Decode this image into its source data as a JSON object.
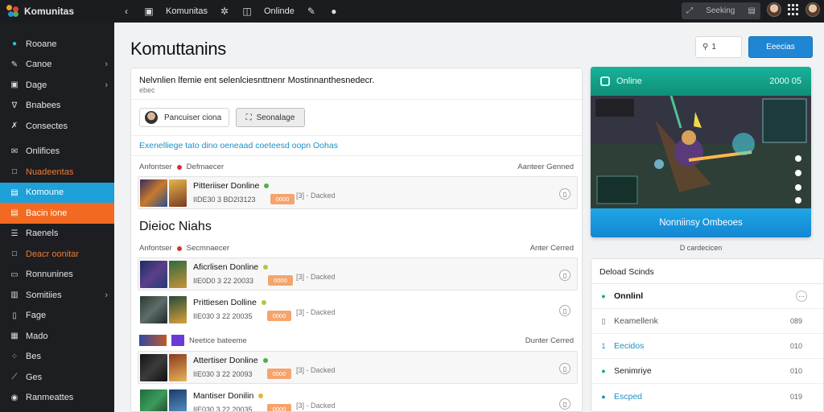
{
  "app": {
    "brand": "Komunitas"
  },
  "topnav": {
    "title": "Komunitas",
    "item": "Onlinde"
  },
  "search": {
    "placeholder": "Seeking"
  },
  "sidebar": {
    "items": [
      {
        "label": "Rooane",
        "icon": "shield-icon"
      },
      {
        "label": "Canoe",
        "icon": "wrench-icon",
        "chevron": true
      },
      {
        "label": "Dage",
        "icon": "folder-icon",
        "chevron": true
      },
      {
        "label": "Bnabees",
        "icon": "cup-icon"
      },
      {
        "label": "Consectes",
        "icon": "tools-icon"
      },
      {
        "label": "Onlifices",
        "icon": "mail-icon"
      },
      {
        "label": "Nuadeentas",
        "icon": "square-icon"
      },
      {
        "label": "Komoune",
        "icon": "card-icon"
      },
      {
        "label": "Bacin ione",
        "icon": "card-icon"
      },
      {
        "label": "Raenels",
        "icon": "list-icon"
      },
      {
        "label": "Deacr oonitar",
        "icon": "square-icon"
      },
      {
        "label": "Ronnunines",
        "icon": "layers-icon"
      },
      {
        "label": "Somitiies",
        "icon": "cards-icon",
        "chevron": true
      },
      {
        "label": "Fage",
        "icon": "page-icon"
      },
      {
        "label": "Mado",
        "icon": "grid-icon"
      },
      {
        "label": "Bes",
        "icon": "dots-icon"
      },
      {
        "label": "Ges",
        "icon": "wand-icon"
      },
      {
        "label": "Ranmeattes",
        "icon": "circle-icon"
      }
    ]
  },
  "main": {
    "title": "Komuttanins",
    "small_input": "1",
    "primary_button": "Eeecias"
  },
  "feed": {
    "heading": "Nelvnlien lfemie ent selenlciesnttnenr Mostinnanthesnedecr.",
    "subheading": "ebec",
    "user_chip": "Pancuiser ciona",
    "ghost_button": "Seonalage",
    "link_text": "Exenelliege tato dino oeneaad coeteesd oopn Oohas",
    "section1": {
      "lead": "Anfontser",
      "tag": "Defmaecer",
      "right": "Aanteer Genned"
    },
    "section2_title": "Dieioc Niahs",
    "section2": {
      "lead": "Anfontser",
      "tag": "Secmnaecer",
      "right": "Anter Cerred"
    },
    "section3": {
      "tag": "Neetice bateeme",
      "right": "Dunter Cerred"
    },
    "rows": [
      {
        "title": "Pitteriiser Donline",
        "meta": "IIDE30 3 BD2I3123",
        "pill": "0000",
        "stat": "[3] - Dacked",
        "dot": "g"
      },
      {
        "title": "Aficrlisen Donline",
        "meta": "IIE0D0 3 22 20033",
        "pill": "0000",
        "stat": "[3] - Dacked",
        "dot": "y"
      },
      {
        "title": "Prittiesen Dolline",
        "meta": "IIE030 3 22 20035",
        "pill": "0000",
        "stat": "[3] - Dacked",
        "dot": "y"
      },
      {
        "title": "Attertiser Donline",
        "meta": "IIE030 3 22 20093",
        "pill": "0000",
        "stat": "[3] - Dacked",
        "dot": "g"
      },
      {
        "title": "Mantiser Donilin",
        "meta": "IIE030 3 22 20035",
        "pill": "0000",
        "stat": "[3] - Dacked",
        "dot": "o"
      }
    ]
  },
  "live": {
    "label": "Online",
    "count": "2000 05",
    "cta": "Nonniinsy Ombeoes",
    "caption": "D cardecicen"
  },
  "list_card": {
    "title": "Deload Scinds",
    "rows": [
      {
        "label": "Onnlinl",
        "value": "",
        "style": "online"
      },
      {
        "label": "Keamellenk",
        "value": "089",
        "style": "plain"
      },
      {
        "label": "Eecidos",
        "value": "010",
        "style": "blue"
      },
      {
        "label": "Senimriye",
        "value": "010",
        "style": "plain"
      },
      {
        "label": "Escped",
        "value": "019",
        "style": "blue"
      }
    ]
  }
}
